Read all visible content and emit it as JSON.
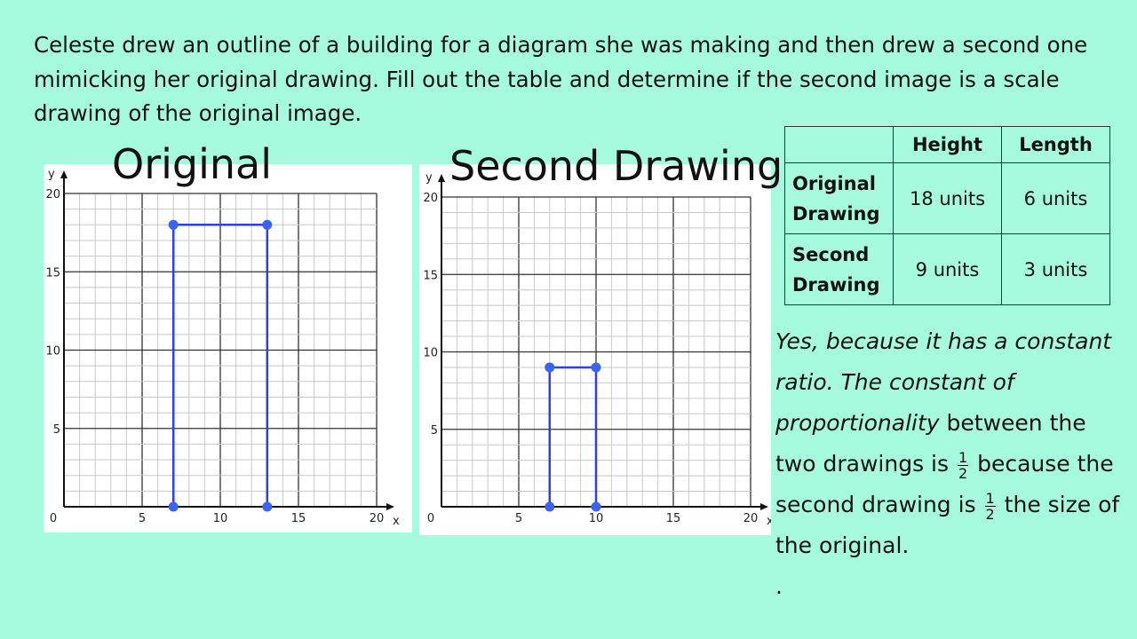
{
  "question": "Celeste drew an outline of a building for a diagram she was making and then drew a second one mimicking her original drawing.  Fill out the table and determine if the second image is a scale drawing of the original image.",
  "chart_data": [
    {
      "type": "line",
      "title": "Original",
      "xlabel": "x",
      "ylabel": "y",
      "xlim": [
        0,
        20
      ],
      "ylim": [
        0,
        20
      ],
      "xticks": [
        "0",
        "5",
        "10",
        "15",
        "20"
      ],
      "yticks": [
        "5",
        "10",
        "15",
        "20"
      ],
      "grid": true,
      "minor_grid_step": 1,
      "major_grid_step": 5,
      "line_color": "#2b3ff0",
      "points": [
        {
          "x": 7,
          "y": 0
        },
        {
          "x": 7,
          "y": 18
        },
        {
          "x": 13,
          "y": 18
        },
        {
          "x": 13,
          "y": 0
        }
      ]
    },
    {
      "type": "line",
      "title": "Second Drawing",
      "xlabel": "x",
      "ylabel": "y",
      "xlim": [
        0,
        20
      ],
      "ylim": [
        0,
        20
      ],
      "xticks": [
        "0",
        "5",
        "10",
        "15",
        "20"
      ],
      "yticks": [
        "5",
        "10",
        "15",
        "20"
      ],
      "grid": true,
      "minor_grid_step": 1,
      "major_grid_step": 5,
      "line_color": "#2b3ff0",
      "points": [
        {
          "x": 7,
          "y": 0
        },
        {
          "x": 7,
          "y": 9
        },
        {
          "x": 10,
          "y": 9
        },
        {
          "x": 10,
          "y": 0
        }
      ]
    }
  ],
  "table": {
    "headers": [
      "",
      "Height",
      "Length"
    ],
    "rows": [
      {
        "label": "Original Drawing",
        "height": "18 units",
        "length": "6 units"
      },
      {
        "label": "Second Drawing",
        "height": "9 units",
        "length": "3 units"
      }
    ]
  },
  "answer": {
    "italic": "Yes, because it has a constant ratio.  The constant of proportionality",
    "part1": " between the two drawings is ",
    "frac_num": "1",
    "frac_den": "2",
    "part2": " because the second drawing is ",
    "part3": " the size of the original.",
    "trailing": "."
  }
}
